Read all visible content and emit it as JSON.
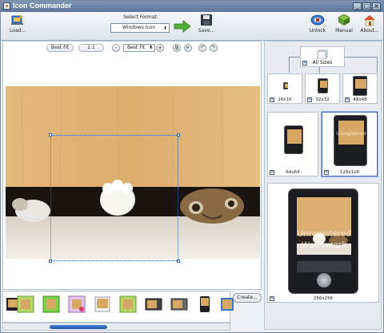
{
  "window": {
    "title": "Icon Commander"
  },
  "toolbar": {
    "load_label": "Load...",
    "select_format_label": "Select Format:",
    "format_value": "Windows Icon",
    "save_label": "Save...",
    "unlock_label": "Unlock",
    "manual_label": "Manual",
    "about_label": "About..."
  },
  "zoom": {
    "best_fit_label": "Best Fit",
    "one_to_one_label": "1:1",
    "zoom_value": "Best Fit"
  },
  "strip": {
    "create_label": "Create..."
  },
  "preview": {
    "all_sizes_label": "All Sizes",
    "sizes": [
      "16x16",
      "32x32",
      "48x48",
      "64x64",
      "128x128",
      "256x256"
    ],
    "selected_size": "128x128",
    "watermark_line1": "Unregistered",
    "watermark_line2": "Watermark"
  },
  "colors": {
    "accent": "#2a67c8",
    "titlebar": "#6b84a6",
    "selection": "#4a6ec8"
  }
}
